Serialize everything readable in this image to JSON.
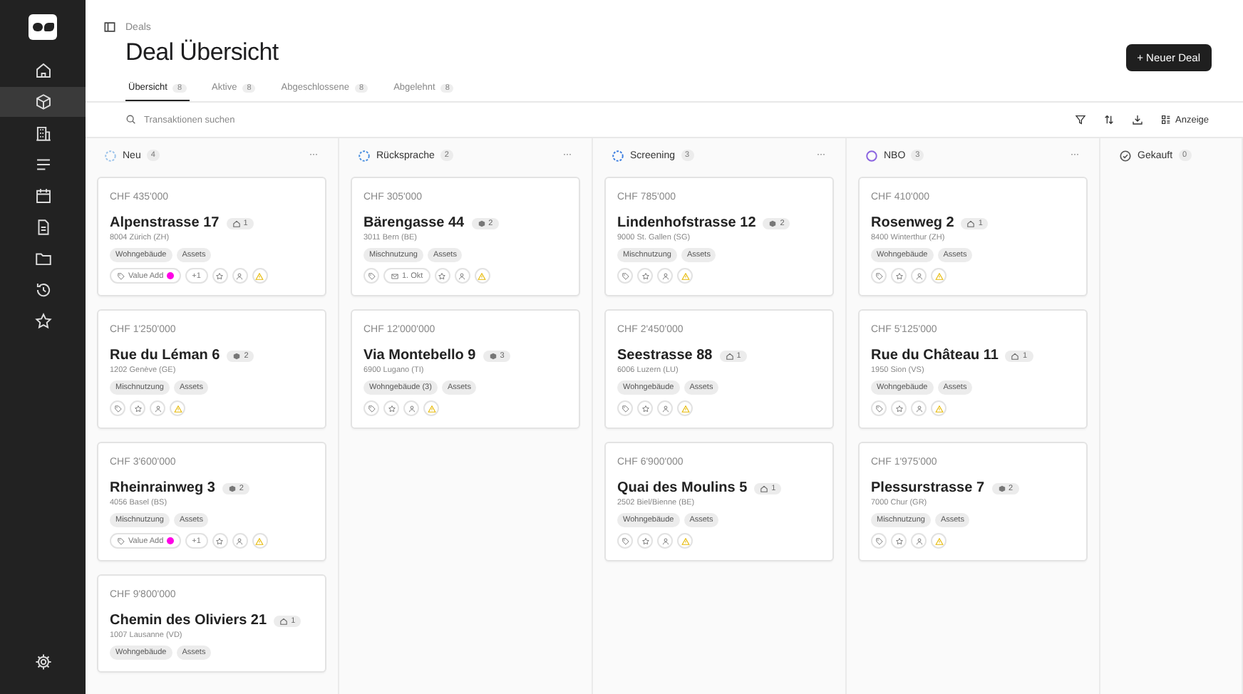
{
  "sidebar": {
    "items": [
      {
        "selected": false
      },
      {
        "selected": true
      },
      {
        "selected": false
      },
      {
        "selected": false
      },
      {
        "selected": false
      },
      {
        "selected": false
      },
      {
        "selected": false
      },
      {
        "selected": false
      },
      {
        "selected": false
      }
    ],
    "bottom": [
      {
        "selected": false
      }
    ]
  },
  "breadcrumb": "Deals",
  "title": "Deal Übersicht",
  "new_button": "+ Neuer Deal",
  "tabs": [
    {
      "label": "Übersicht",
      "count": "8",
      "selected": true
    },
    {
      "label": "Aktive",
      "count": "8",
      "selected": false
    },
    {
      "label": "Abgeschlossene",
      "count": "8",
      "selected": false
    },
    {
      "label": "Abgelehnt",
      "count": "8",
      "selected": false
    }
  ],
  "search": {
    "placeholder": "Transaktionen suchen"
  },
  "toolbar": {
    "display_button": "Anzeige"
  },
  "columns": [
    {
      "name": "Neu",
      "count": "4",
      "kind": "dashed",
      "color": "#9cc3ea",
      "menu": "···",
      "cards": [
        {
          "price": "CHF 435'000",
          "title": "Alpenstrasse 17",
          "kind": "house",
          "units": "1",
          "address": "8004 Zürich (ZH)",
          "tags": [
            "Wohngebäude",
            "Assets"
          ],
          "footer": [
            {
              "kind": "tag",
              "label": "Value Add",
              "color": "#ff00e6"
            },
            {
              "kind": "count",
              "label": "+1"
            },
            {
              "kind": "star"
            },
            {
              "kind": "person"
            },
            {
              "kind": "warning"
            }
          ]
        },
        {
          "price": "CHF 1'250'000",
          "title": "Rue du Léman 6",
          "kind": "block",
          "units": "2",
          "address": "1202 Genève (GE)",
          "tags": [
            "Mischnutzung",
            "Assets"
          ],
          "footer": [
            {
              "kind": "tag"
            },
            {
              "kind": "star"
            },
            {
              "kind": "person"
            },
            {
              "kind": "warning"
            }
          ]
        },
        {
          "price": "CHF 3'600'000",
          "title": "Rheinrainweg 3",
          "kind": "block",
          "units": "2",
          "address": "4056 Basel (BS)",
          "tags": [
            "Mischnutzung",
            "Assets"
          ],
          "footer": [
            {
              "kind": "tag",
              "label": "Value Add",
              "color": "#ff00e6"
            },
            {
              "kind": "count",
              "label": "+1"
            },
            {
              "kind": "star"
            },
            {
              "kind": "person"
            },
            {
              "kind": "warning"
            }
          ]
        },
        {
          "price": "CHF 9'800'000",
          "title": "Chemin des Oliviers 21",
          "kind": "house",
          "units": "1",
          "address": "1007 Lausanne (VD)",
          "tags": [
            "Wohngebäude",
            "Assets"
          ]
        }
      ]
    },
    {
      "name": "Rücksprache",
      "count": "2",
      "kind": "dashed",
      "color": "#4a8fe0",
      "menu": "···",
      "cards": [
        {
          "price": "CHF 305'000",
          "title": "Bärengasse 44",
          "kind": "block",
          "units": "2",
          "address": "3011 Bern (BE)",
          "tags": [
            "Mischnutzung",
            "Assets"
          ],
          "footer": [
            {
              "kind": "tag"
            },
            {
              "kind": "date",
              "label": "1. Okt"
            },
            {
              "kind": "star"
            },
            {
              "kind": "person"
            },
            {
              "kind": "warning"
            }
          ]
        },
        {
          "price": "CHF 12'000'000",
          "title": "Via Montebello 9",
          "kind": "block",
          "units": "3",
          "address": "6900 Lugano (TI)",
          "tags": [
            "Wohngebäude (3)",
            "Assets"
          ],
          "footer": [
            {
              "kind": "tag"
            },
            {
              "kind": "star"
            },
            {
              "kind": "person"
            },
            {
              "kind": "warning"
            }
          ]
        }
      ]
    },
    {
      "name": "Screening",
      "count": "3",
      "kind": "dashed",
      "color": "#3b7de0",
      "menu": "···",
      "cards": [
        {
          "price": "CHF 785'000",
          "title": "Lindenhofstrasse 12",
          "kind": "block",
          "units": "2",
          "address": "9000 St. Gallen (SG)",
          "tags": [
            "Mischnutzung",
            "Assets"
          ],
          "footer": [
            {
              "kind": "tag"
            },
            {
              "kind": "star"
            },
            {
              "kind": "person"
            },
            {
              "kind": "warning"
            }
          ]
        },
        {
          "price": "CHF 2'450'000",
          "title": "Seestrasse 88",
          "kind": "house",
          "units": "1",
          "address": "6006 Luzern (LU)",
          "tags": [
            "Wohngebäude",
            "Assets"
          ],
          "footer": [
            {
              "kind": "tag"
            },
            {
              "kind": "star"
            },
            {
              "kind": "person"
            },
            {
              "kind": "warning"
            }
          ]
        },
        {
          "price": "CHF 6'900'000",
          "title": "Quai des Moulins 5",
          "kind": "house",
          "units": "1",
          "address": "2502 Biel/Bienne (BE)",
          "tags": [
            "Wohngebäude",
            "Assets"
          ],
          "footer": [
            {
              "kind": "tag"
            },
            {
              "kind": "star"
            },
            {
              "kind": "person"
            },
            {
              "kind": "warning"
            }
          ]
        }
      ]
    },
    {
      "name": "NBO",
      "count": "3",
      "kind": "solid",
      "color": "#8a63e0",
      "menu": "···",
      "cards": [
        {
          "price": "CHF 410'000",
          "title": "Rosenweg 2",
          "kind": "house",
          "units": "1",
          "address": "8400 Winterthur (ZH)",
          "tags": [
            "Wohngebäude",
            "Assets"
          ],
          "footer": [
            {
              "kind": "tag"
            },
            {
              "kind": "star"
            },
            {
              "kind": "person"
            },
            {
              "kind": "warning"
            }
          ]
        },
        {
          "price": "CHF 5'125'000",
          "title": "Rue du Château 11",
          "kind": "house",
          "units": "1",
          "address": "1950 Sion (VS)",
          "tags": [
            "Wohngebäude",
            "Assets"
          ],
          "footer": [
            {
              "kind": "tag"
            },
            {
              "kind": "star"
            },
            {
              "kind": "person"
            },
            {
              "kind": "warning"
            }
          ]
        },
        {
          "price": "CHF 1'975'000",
          "title": "Plessurstrasse 7",
          "kind": "block",
          "units": "2",
          "address": "7000 Chur (GR)",
          "tags": [
            "Mischnutzung",
            "Assets"
          ],
          "footer": [
            {
              "kind": "tag"
            },
            {
              "kind": "star"
            },
            {
              "kind": "person"
            },
            {
              "kind": "warning"
            }
          ]
        }
      ]
    },
    {
      "name": "Gekauft",
      "count": "0",
      "kind": "check",
      "color": "#555555"
    }
  ]
}
